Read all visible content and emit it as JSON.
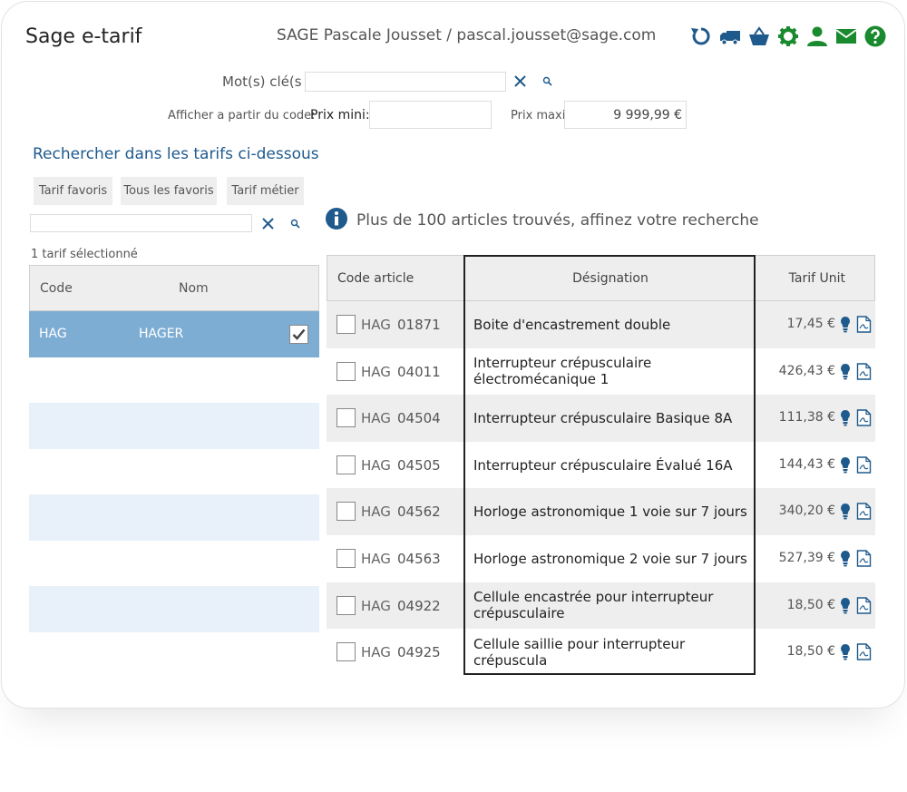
{
  "header": {
    "app_title": "Sage e-tarif",
    "user_info": "SAGE Pascale Jousset / pascal.jousset@sage.com",
    "toolbar": [
      {
        "icon": "refresh-icon",
        "color": "#1f5a8c"
      },
      {
        "icon": "truck-icon",
        "color": "#1f5a8c"
      },
      {
        "icon": "basket-icon",
        "color": "#1f5a8c"
      },
      {
        "icon": "gear-icon",
        "color": "#1a8a2e"
      },
      {
        "icon": "user-icon",
        "color": "#1a8a2e"
      },
      {
        "icon": "mail-icon",
        "color": "#1a8a2e"
      },
      {
        "icon": "help-icon",
        "color": "#1a8a2e"
      }
    ]
  },
  "search": {
    "keywords_label": "Mot(s) clé(s",
    "keywords_value": "",
    "code_label": "Afficher a partir du code:",
    "prix_mini_label": "Prix mini:",
    "prix_mini_value": "",
    "prix_maxi_label": "Prix maxi",
    "prix_maxi_value": "9 999,99 €"
  },
  "section_title": "Rechercher dans les tarifs ci-dessous",
  "tabs": [
    "Tarif favoris",
    "Tous les favoris",
    "Tarif métier"
  ],
  "tarif_filter_value": "",
  "selection_count": "1 tarif sélectionné",
  "tarif_table": {
    "columns": [
      "Code",
      "Nom"
    ],
    "rows": [
      {
        "code": "HAG",
        "nom": "HAGER",
        "selected": true
      }
    ]
  },
  "info_message": "Plus de 100 articles trouvés, affinez votre recherche",
  "articles": {
    "columns": [
      "Code article",
      "Désignation",
      "Tarif Unit"
    ],
    "rows": [
      {
        "prefix": "HAG",
        "num": "01871",
        "designation": "Boite d'encastrement double",
        "price": "17,45 €"
      },
      {
        "prefix": "HAG",
        "num": "04011",
        "designation": "Interrupteur crépusculaire électromécanique 1",
        "price": "426,43 €"
      },
      {
        "prefix": "HAG",
        "num": "04504",
        "designation": "Interrupteur crépusculaire Basique 8A",
        "price": "111,38 €"
      },
      {
        "prefix": "HAG",
        "num": "04505",
        "designation": "Interrupteur crépusculaire Évalué 16A",
        "price": "144,43 €"
      },
      {
        "prefix": "HAG",
        "num": "04562",
        "designation": "Horloge astronomique 1 voie sur 7 jours",
        "price": "340,20 €"
      },
      {
        "prefix": "HAG",
        "num": "04563",
        "designation": "Horloge astronomique 2 voie sur 7 jours",
        "price": "527,39 €"
      },
      {
        "prefix": "HAG",
        "num": "04922",
        "designation": "Cellule encastrée pour interrupteur crépusculaire",
        "price": "18,50 €"
      },
      {
        "prefix": "HAG",
        "num": "04925",
        "designation": "Cellule saillie pour interrupteur crépuscula",
        "price": "18,50 €"
      }
    ]
  },
  "colors": {
    "accent": "#1f5a8c",
    "green": "#1a8a2e",
    "selected_row": "#7eadd4",
    "alt_row": "#e8f1fa"
  }
}
